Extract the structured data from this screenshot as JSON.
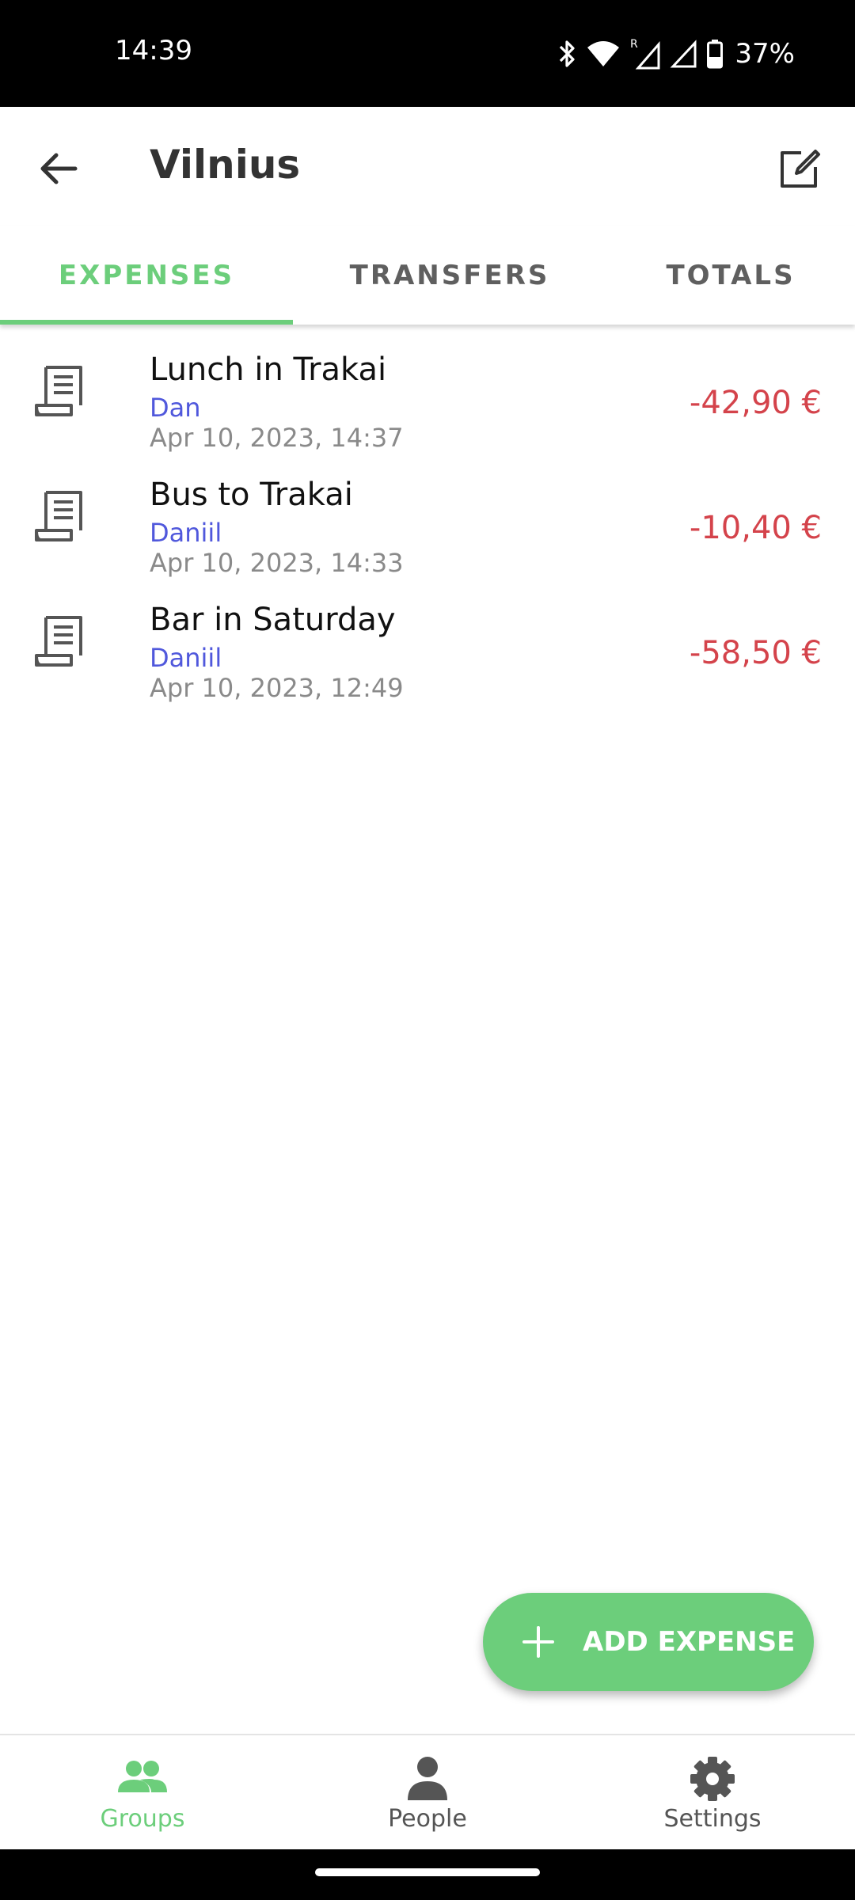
{
  "status_bar": {
    "time": "14:39",
    "battery": "37%",
    "icons": [
      "bluetooth-icon",
      "wifi-icon",
      "signal-roaming-icon",
      "signal-icon",
      "battery-icon"
    ]
  },
  "app_bar": {
    "title": "Vilnius",
    "back_icon": "arrow-back-icon",
    "edit_icon": "edit-icon"
  },
  "tabs": [
    {
      "label": "EXPENSES",
      "active": true
    },
    {
      "label": "TRANSFERS",
      "active": false
    },
    {
      "label": "TOTALS",
      "active": false
    }
  ],
  "expenses": [
    {
      "title": "Lunch in Trakai",
      "payer": "Dan",
      "date": "Apr 10, 2023, 14:37",
      "amount": "-42,90 €",
      "icon": "receipt-icon"
    },
    {
      "title": "Bus to Trakai",
      "payer": "Daniil",
      "date": "Apr 10, 2023, 14:33",
      "amount": "-10,40 €",
      "icon": "receipt-icon"
    },
    {
      "title": "Bar in Saturday",
      "payer": "Daniil",
      "date": "Apr 10, 2023, 12:49",
      "amount": "-58,50 €",
      "icon": "receipt-icon"
    }
  ],
  "fab": {
    "label": "ADD EXPENSE",
    "icon": "plus-icon"
  },
  "bottom_nav": [
    {
      "label": "Groups",
      "icon": "groups-icon",
      "active": true
    },
    {
      "label": "People",
      "icon": "person-icon",
      "active": false
    },
    {
      "label": "Settings",
      "icon": "gear-icon",
      "active": false
    }
  ],
  "colors": {
    "accent": "#6cce7b",
    "payer": "#5058dc",
    "amount_negative": "#d4434b",
    "date": "#8a8a8a"
  }
}
